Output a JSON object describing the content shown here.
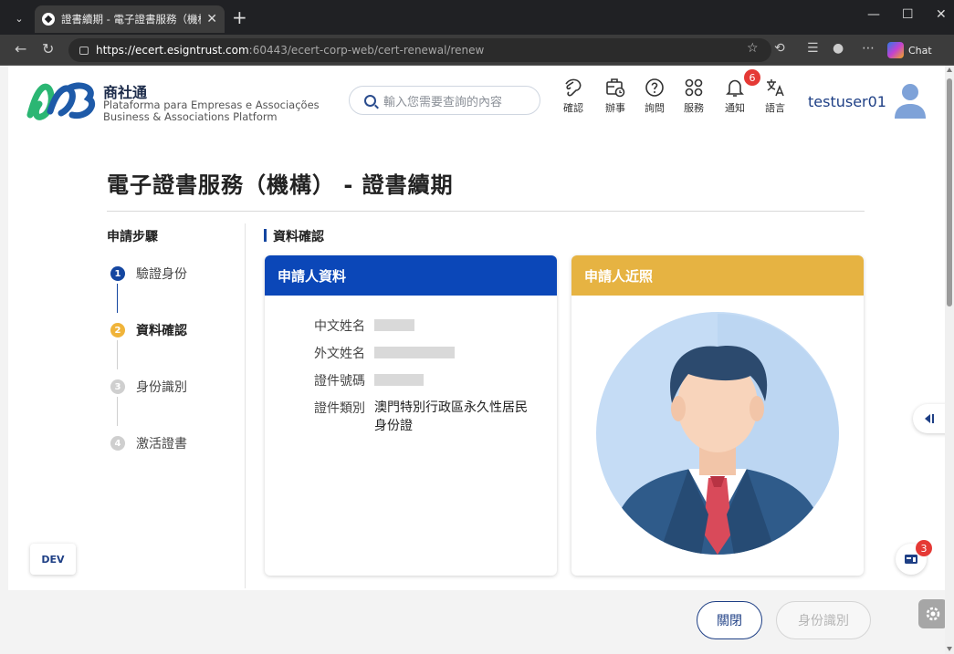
{
  "browser": {
    "tab_title": "證書續期 - 電子證書服務（機構）",
    "url_host": "https://ecert.esigntrust.com",
    "url_path": ":60443/ecert-corp-web/cert-renewal/renew",
    "chat_label": "Chat"
  },
  "header": {
    "brand_zh": "商社通",
    "brand_pt": "Plataforma para Empresas e Associações",
    "brand_en": "Business & Associations Platform",
    "search_placeholder": "輸入您需要查詢的內容",
    "nav": [
      {
        "label": "確認",
        "icon": "handshake-icon"
      },
      {
        "label": "辦事",
        "icon": "briefcase-clock-icon"
      },
      {
        "label": "詢問",
        "icon": "question-icon"
      },
      {
        "label": "服務",
        "icon": "grid-icon"
      },
      {
        "label": "通知",
        "icon": "bell-icon"
      },
      {
        "label": "語言",
        "icon": "translate-icon"
      }
    ],
    "notification_count": "6",
    "username": "testuser01"
  },
  "page": {
    "title": "電子證書服務（機構） - 證書續期",
    "steps_title": "申請步驟",
    "steps": [
      {
        "num": "1",
        "label": "驗證身份",
        "state": "done"
      },
      {
        "num": "2",
        "label": "資料確認",
        "state": "active"
      },
      {
        "num": "3",
        "label": "身份識別",
        "state": "pending"
      },
      {
        "num": "4",
        "label": "激活證書",
        "state": "pending"
      }
    ],
    "section_label": "資料確認",
    "applicant_card": {
      "title": "申請人資料",
      "rows": [
        {
          "label": "中文姓名",
          "value": ""
        },
        {
          "label": "外文姓名",
          "value": ""
        },
        {
          "label": "證件號碼",
          "value": ""
        },
        {
          "label": "證件類別",
          "value": "澳門特別行政區永久性居民",
          "value2": "身份證"
        }
      ]
    },
    "photo_card": {
      "title": "申請人近照"
    },
    "buttons": {
      "close": "關閉",
      "identify": "身份識別"
    },
    "dev_label": "DEV",
    "message_count": "3"
  },
  "colors": {
    "primary": "#1446a0",
    "header_blue": "#0b47b8",
    "header_gold": "#e6b342",
    "step_active": "#f0b43a",
    "badge_red": "#e53935"
  }
}
